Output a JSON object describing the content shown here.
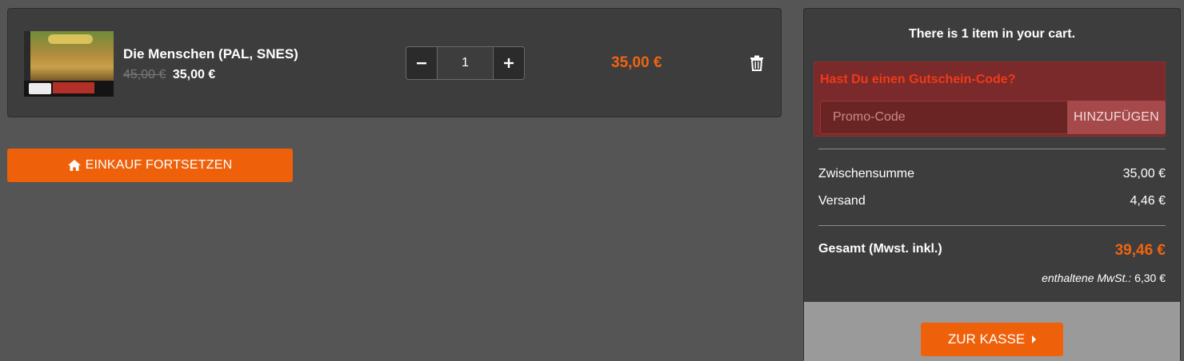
{
  "cart_item": {
    "title": "Die Menschen (PAL, SNES)",
    "old_price": "45,00 €",
    "price": "35,00 €",
    "quantity": "1",
    "line_total": "35,00 €",
    "decrement_icon": "minus-icon",
    "increment_icon": "plus-icon",
    "delete_icon": "trash-icon"
  },
  "continue_button": {
    "label": "EINKAUF FORTSETZEN",
    "icon": "home-icon"
  },
  "summary": {
    "header": "There is 1 item in your cart.",
    "promo": {
      "title": "Hast Du einen Gutschein-Code?",
      "placeholder": "Promo-Code",
      "button_label": "HINZUFÜGEN"
    },
    "subtotal_label": "Zwischensumme",
    "subtotal_value": "35,00 €",
    "shipping_label": "Versand",
    "shipping_value": "4,46 €",
    "total_label": "Gesamt (Mwst. inkl.)",
    "total_value": "39,46 €",
    "tax_label": "enthaltene MwSt.:",
    "tax_value": "6,30 €",
    "checkout_label": "ZUR KASSE"
  },
  "colors": {
    "accent": "#ef600a",
    "background": "#555555",
    "panel": "#3d3d3d",
    "promo_bg": "#7a2a2a"
  }
}
